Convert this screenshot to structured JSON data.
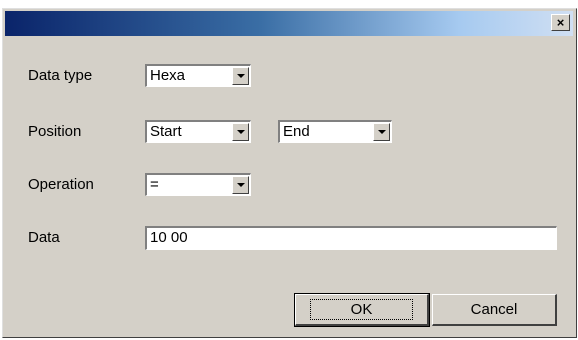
{
  "dialog": {
    "close_label": "×"
  },
  "fields": {
    "data_type": {
      "label": "Data type",
      "value": "Hexa"
    },
    "position": {
      "label": "Position",
      "start_value": "Start",
      "end_value": "End"
    },
    "operation": {
      "label": "Operation",
      "value": "="
    },
    "data": {
      "label": "Data",
      "value": "10 00"
    }
  },
  "buttons": {
    "ok_label": "OK",
    "cancel_label": "Cancel"
  }
}
